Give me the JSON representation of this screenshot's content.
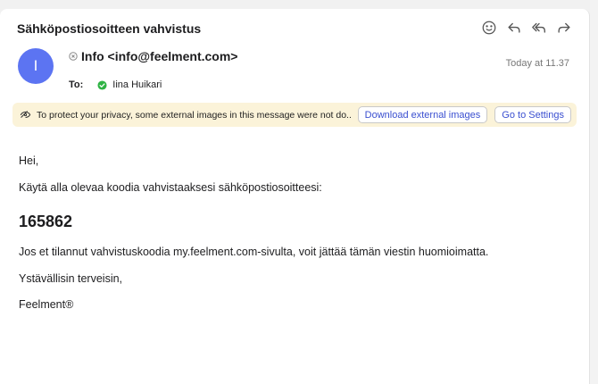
{
  "email": {
    "subject": "Sähköpostiosoitteen vahvistus",
    "avatar_initial": "I",
    "from": "Info <info@feelment.com>",
    "to_label": "To:",
    "to_name": "Iina Huikari",
    "date": "Today at 11.37"
  },
  "toolbar": {
    "icons": [
      "smiley-icon",
      "reply-icon",
      "reply-all-icon",
      "forward-icon"
    ]
  },
  "privacy": {
    "text": "To protect your privacy, some external images in this message were not do...",
    "download_label": "Download external images",
    "settings_label": "Go to Settings"
  },
  "body": {
    "greeting": "Hei,",
    "instruction": "Käytä alla olevaa koodia vahvistaaksesi sähköpostiosoitteesi:",
    "code": "165862",
    "ignore_note": "Jos et tilannut vahvistuskoodia my.feelment.com-sivulta, voit jättää tämän viestin huomioimatta.",
    "closing": "Ystävällisin terveisin,",
    "signature": "Feelment®"
  },
  "colors": {
    "avatar": "#5c74f2",
    "privacy_bar": "#fbf3d9",
    "link_button_text": "#3a4fd0",
    "verified": "#2fb344"
  }
}
